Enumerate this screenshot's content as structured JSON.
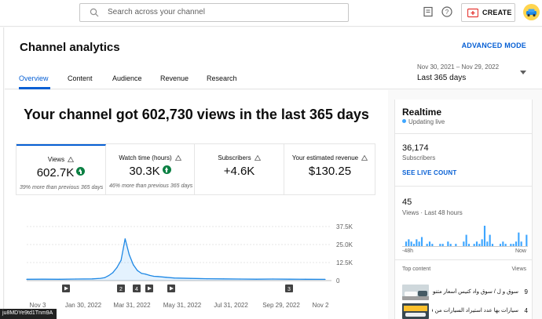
{
  "search": {
    "placeholder": "Search across your channel"
  },
  "topbar": {
    "create_label": "CREATE"
  },
  "header": {
    "title": "Channel analytics",
    "advanced_mode": "ADVANCED MODE",
    "tabs": [
      {
        "label": "Overview"
      },
      {
        "label": "Content"
      },
      {
        "label": "Audience"
      },
      {
        "label": "Revenue"
      },
      {
        "label": "Research"
      }
    ],
    "date_range": "Nov 30, 2021 – Nov 29, 2022",
    "period": "Last 365 days"
  },
  "main": {
    "headline": "Your channel got 602,730 views in the last 365 days",
    "metrics": [
      {
        "label": "Views",
        "value": "602.7K",
        "sub": "39% more than previous 365 days",
        "trend": "up"
      },
      {
        "label": "Watch time (hours)",
        "value": "30.3K",
        "sub": "46% more than previous 365 days",
        "trend": "up"
      },
      {
        "label": "Subscribers",
        "value": "+4.6K",
        "sub": "",
        "trend": ""
      },
      {
        "label": "Your estimated revenue",
        "value": "$130.25",
        "sub": "",
        "trend": ""
      }
    ]
  },
  "chart_data": {
    "type": "line",
    "x_tick_labels": [
      "Nov 3",
      "Jan 30, 2022",
      "Mar 31, 2022",
      "May 31, 2022",
      "Jul 31, 2022",
      "Sep 29, 2022",
      "Nov 2"
    ],
    "y_tick_labels": [
      "37.5K",
      "25.0K",
      "12.5K",
      "0"
    ],
    "ylim": [
      0,
      37500
    ],
    "x_day_index": [
      0,
      20,
      40,
      60,
      80,
      90,
      95,
      100,
      105,
      110,
      115,
      120,
      125,
      130,
      135,
      140,
      145,
      150,
      155,
      160,
      170,
      180,
      200,
      220,
      240,
      260,
      280,
      300,
      320,
      340,
      364
    ],
    "values": [
      900,
      1000,
      950,
      1100,
      1200,
      1600,
      2000,
      3500,
      5500,
      9000,
      14000,
      29000,
      18000,
      11000,
      7000,
      5000,
      4500,
      3600,
      3000,
      2800,
      2300,
      1800,
      1500,
      1300,
      1200,
      1100,
      1000,
      1100,
      1000,
      900,
      850
    ],
    "markers": [
      {
        "label": "",
        "kind": "play"
      },
      {
        "label": "2",
        "kind": "number"
      },
      {
        "label": "4",
        "kind": "number"
      },
      {
        "label": "",
        "kind": "play"
      },
      {
        "label": "",
        "kind": "play"
      },
      {
        "label": "3",
        "kind": "number"
      }
    ],
    "grid": true
  },
  "realtime": {
    "title": "Realtime",
    "status": "Updating live",
    "subscribers": "36,174",
    "subscribers_label": "Subscribers",
    "link": "SEE LIVE COUNT",
    "views": "45",
    "views_label": "Views · Last 48 hours",
    "axis_start": "-48h",
    "axis_end": "Now",
    "bars": [
      0,
      2,
      3,
      2,
      1,
      3,
      2,
      4,
      0,
      1,
      2,
      1,
      0,
      0,
      1,
      1,
      0,
      2,
      1,
      0,
      1,
      0,
      0,
      2,
      5,
      1,
      0,
      1,
      2,
      1,
      3,
      9,
      2,
      5,
      1,
      0,
      0,
      1,
      2,
      1,
      0,
      1,
      1,
      2,
      6,
      2,
      0,
      5
    ],
    "top_content_label": "Top content",
    "views_col_label": "Views",
    "top_content": [
      {
        "title": "سوق و ل / سوق واد كنيس أسعار متنوعة",
        "views": "9"
      },
      {
        "title": "سيارات بها عدد استيراد السيارات من فرنسا",
        "views": "4"
      }
    ]
  },
  "tooltip": {
    "text": "ju8MDYe9td1Tnm9A"
  }
}
